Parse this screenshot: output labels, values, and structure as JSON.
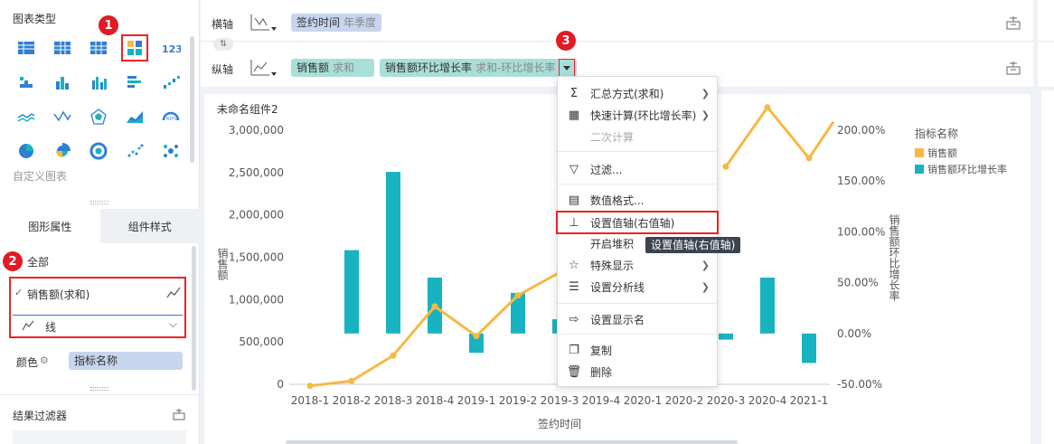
{
  "left_panel": {
    "chart_type_title": "图表类型",
    "custom_chart": "自定义图表",
    "tabs": [
      "图形属性",
      "组件样式"
    ],
    "all_label": "全部",
    "series_item": "销售额(求和)",
    "shape_select": "线",
    "color_label": "颜色",
    "color_value": "指标名称",
    "filter_title": "结果过滤器"
  },
  "badges": [
    "1",
    "2",
    "3"
  ],
  "axes": {
    "x_label": "横轴",
    "y_label": "纵轴",
    "x_field": "签约时间",
    "x_field_sub": "年季度",
    "y_field1": "销售额",
    "y_field1_sub": "求和",
    "y_field2": "销售额环比增长率",
    "y_field2_sub": "求和-环比增长率"
  },
  "component_title": "未命名组件2",
  "menu": {
    "items": [
      "汇总方式(求和)",
      "快速计算(环比增长率)",
      "二次计算",
      "过滤...",
      "数值格式...",
      "设置值轴(右值轴)",
      "开启堆积",
      "特殊显示",
      "设置分析线",
      "设置显示名",
      "复制",
      "删除"
    ],
    "tooltip": "设置值轴(右值轴)"
  },
  "chart_data": {
    "type": "bar",
    "categories": [
      "2018-1",
      "2018-2",
      "2018-3",
      "2018-4",
      "2019-1",
      "2019-2",
      "2019-3",
      "2019-4",
      "2020-1",
      "2020-2",
      "2020-3",
      "2020-4",
      "2021-1"
    ],
    "xlabel": "签约时间",
    "ylabel": "销售额",
    "y2label": "销售额环比增长率",
    "left_ticks": [
      "3,000,000",
      "2,500,000",
      "2,000,000",
      "1,500,000",
      "1,000,000",
      "500,000",
      "0"
    ],
    "right_ticks": [
      "200.00%",
      "150.00%",
      "100.00%",
      "50.00%",
      "0.00%",
      "-50.00%"
    ],
    "legend_title": "指标名称",
    "series": [
      {
        "name": "销售额",
        "color": "#f5b945",
        "type": "line",
        "values": [
          -18000,
          40000,
          340000,
          920000,
          570000,
          1050000,
          1320000,
          null,
          null,
          null,
          2570000,
          3270000,
          2670000
        ]
      },
      {
        "name": "销售额环比增长率",
        "color": "#17b3c1",
        "type": "bar",
        "values": [
          null,
          0.82,
          1.59,
          0.55,
          -0.19,
          0.4,
          0.14,
          null,
          null,
          null,
          -0.06,
          0.55,
          -0.29
        ]
      }
    ],
    "line_extra_end": 3100000
  }
}
